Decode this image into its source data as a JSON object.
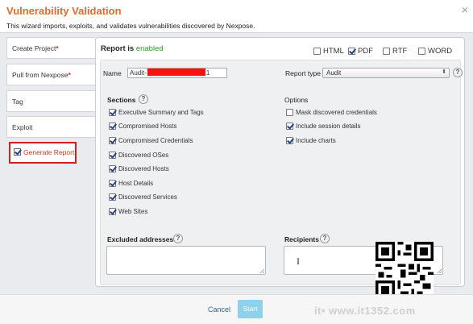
{
  "window": {
    "title": "Vulnerability Validation",
    "subtitle": "This wizard imports, exploits, and validates vulnerabilities discovered by Nexpose."
  },
  "steps": [
    {
      "label": "Create Project",
      "required": "*"
    },
    {
      "label": "Pull from Nexpose",
      "required": "*"
    },
    {
      "label": "Tag",
      "required": ""
    },
    {
      "label": "Exploit",
      "required": ""
    },
    {
      "label": "Generate Report",
      "required": ""
    }
  ],
  "report": {
    "status_prefix": "Report is",
    "status_value": "enabled",
    "formats": [
      {
        "label": "HTML",
        "checked": false
      },
      {
        "label": "PDF",
        "checked": true
      },
      {
        "label": "RTF",
        "checked": false
      },
      {
        "label": "WORD",
        "checked": false
      }
    ],
    "name_label": "Name",
    "name_prefix": "Audit-",
    "name_suffix": "1",
    "type_label": "Report type",
    "type_value": "Audit",
    "help_glyph": "?"
  },
  "sections": {
    "heading": "Sections",
    "items": [
      {
        "label": "Executive Summary and Tags",
        "checked": true
      },
      {
        "label": "Compromised Hosts",
        "checked": true
      },
      {
        "label": "Compromised Credentials",
        "checked": true
      },
      {
        "label": "Discovered OSes",
        "checked": true
      },
      {
        "label": "Discovered Hosts",
        "checked": true
      },
      {
        "label": "Host Details",
        "checked": true
      },
      {
        "label": "Discovered Services",
        "checked": true
      },
      {
        "label": "Web Sites",
        "checked": true
      }
    ]
  },
  "options": {
    "heading": "Options",
    "items": [
      {
        "label": "Mask discovered credentials",
        "checked": false
      },
      {
        "label": "Include session details",
        "checked": true
      },
      {
        "label": "Include charts",
        "checked": true
      }
    ]
  },
  "excluded_addresses": {
    "label": "Excluded addresses",
    "value": ""
  },
  "recipients": {
    "label": "Recipients",
    "value": "I"
  },
  "footer": {
    "cancel_label": "Cancel",
    "start_label": "Start"
  },
  "watermark": "it• www.it1352.com",
  "close_glyph": "×"
}
